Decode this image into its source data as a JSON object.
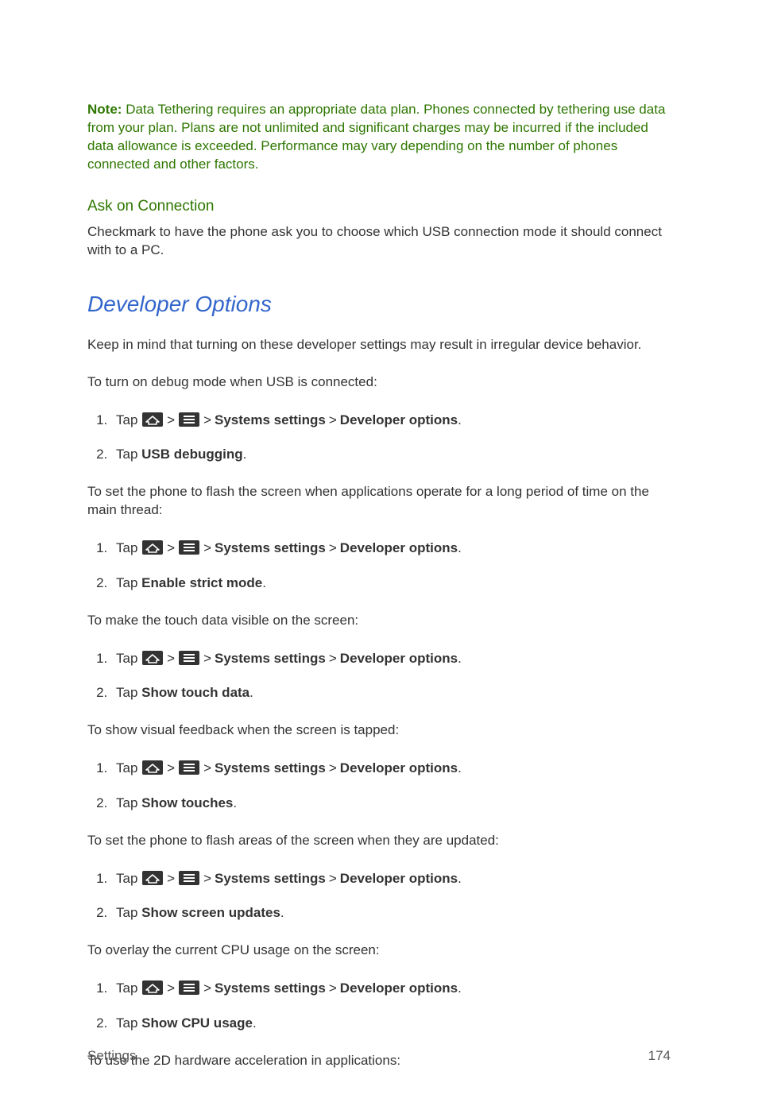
{
  "note": {
    "label": "Note:",
    "text": "Data Tethering requires an appropriate data plan. Phones connected by tethering use data from your plan. Plans are not unlimited and significant charges may be incurred if the included data allowance is exceeded. Performance may vary depending on the number of phones connected and other factors."
  },
  "ask_heading": "Ask on Connection",
  "ask_body": "Checkmark to have the phone ask you to choose which USB connection mode it should connect with to a PC.",
  "dev_heading": "Developer Options",
  "dev_intro": "Keep in mind that turning on these developer settings may result in irregular device behavior.",
  "nav": {
    "tap": "Tap",
    "systems_settings": "Systems settings",
    "developer_options": "Developer options",
    "sep": ">",
    "period": "."
  },
  "sections": [
    {
      "intro": "To turn on debug mode when USB is connected:",
      "step2_prefix": "Tap ",
      "step2_bold": "USB debugging",
      "step2_suffix": "."
    },
    {
      "intro": "To set the phone to flash the screen when applications operate for a long period of time on the main thread:",
      "step2_prefix": "Tap ",
      "step2_bold": "Enable strict mode",
      "step2_suffix": "."
    },
    {
      "intro": "To make the touch data visible on the screen:",
      "step2_prefix": "Tap ",
      "step2_bold": "Show touch data",
      "step2_suffix": "."
    },
    {
      "intro": "To show visual feedback when the screen is tapped:",
      "step2_prefix": "Tap ",
      "step2_bold": "Show touches",
      "step2_suffix": "."
    },
    {
      "intro": "To set the phone to flash areas of the screen when they are updated:",
      "step2_prefix": "Tap ",
      "step2_bold": "Show screen updates",
      "step2_suffix": "."
    },
    {
      "intro": "To overlay the current CPU usage on the screen:",
      "step2_prefix": "Tap ",
      "step2_bold": "Show CPU usage",
      "step2_suffix": "."
    }
  ],
  "last_intro": "To use the 2D hardware acceleration in applications:",
  "footer": {
    "section": "Settings",
    "page": "174"
  }
}
